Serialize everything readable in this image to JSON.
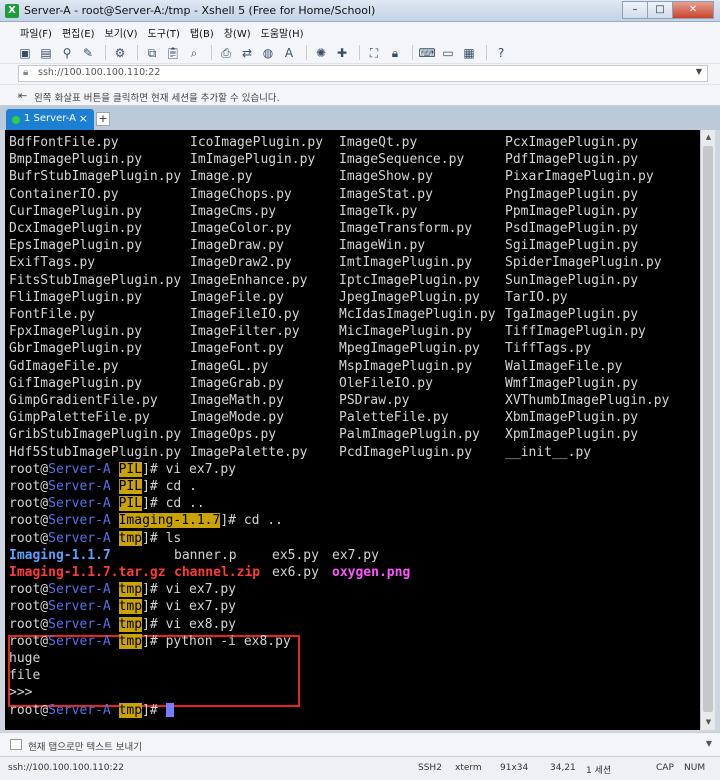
{
  "window": {
    "title": "Server-A - root@Server-A:/tmp - Xshell 5 (Free for Home/School)",
    "controls": [
      "–",
      "□",
      "✕"
    ]
  },
  "menu": [
    "파일(F)",
    "편집(E)",
    "보기(V)",
    "도구(T)",
    "탭(B)",
    "창(W)",
    "도움말(H)"
  ],
  "toolbar_icons": [
    "new-session-icon",
    "open-folder-icon",
    "connect-icon",
    "disconnect-icon",
    "properties-icon",
    "copy-icon",
    "paste-icon",
    "find-icon",
    "print-icon",
    "transfer-icon",
    "globe-icon",
    "font-icon",
    "xftp-icon",
    "xmanager-icon",
    "fullscreen-icon",
    "lock-icon",
    "keyboard-icon",
    "compose-icon",
    "tabs-icon",
    "help-icon"
  ],
  "address": {
    "value": "ssh://100.100.100.110:22"
  },
  "hint": {
    "text": "왼쪽 화살표 버튼을 클릭하면 현재 세션을 추가할 수 있습니다."
  },
  "tab": {
    "label": "1 Server-A",
    "close": "×",
    "add": "+"
  },
  "terminal": {
    "listing": [
      [
        "BdfFontFile.py",
        "IcoImagePlugin.py",
        "ImageQt.py",
        "PcxImagePlugin.py"
      ],
      [
        "BmpImagePlugin.py",
        "ImImagePlugin.py",
        "ImageSequence.py",
        "PdfImagePlugin.py"
      ],
      [
        "BufrStubImagePlugin.py",
        "Image.py",
        "ImageShow.py",
        "PixarImagePlugin.py"
      ],
      [
        "ContainerIO.py",
        "ImageChops.py",
        "ImageStat.py",
        "PngImagePlugin.py"
      ],
      [
        "CurImagePlugin.py",
        "ImageCms.py",
        "ImageTk.py",
        "PpmImagePlugin.py"
      ],
      [
        "DcxImagePlugin.py",
        "ImageColor.py",
        "ImageTransform.py",
        "PsdImagePlugin.py"
      ],
      [
        "EpsImagePlugin.py",
        "ImageDraw.py",
        "ImageWin.py",
        "SgiImagePlugin.py"
      ],
      [
        "ExifTags.py",
        "ImageDraw2.py",
        "ImtImagePlugin.py",
        "SpiderImagePlugin.py"
      ],
      [
        "FitsStubImagePlugin.py",
        "ImageEnhance.py",
        "IptcImagePlugin.py",
        "SunImagePlugin.py"
      ],
      [
        "FliImagePlugin.py",
        "ImageFile.py",
        "JpegImagePlugin.py",
        "TarIO.py"
      ],
      [
        "FontFile.py",
        "ImageFileIO.py",
        "McIdasImagePlugin.py",
        "TgaImagePlugin.py"
      ],
      [
        "FpxImagePlugin.py",
        "ImageFilter.py",
        "MicImagePlugin.py",
        "TiffImagePlugin.py"
      ],
      [
        "GbrImagePlugin.py",
        "ImageFont.py",
        "MpegImagePlugin.py",
        "TiffTags.py"
      ],
      [
        "GdImageFile.py",
        "ImageGL.py",
        "MspImagePlugin.py",
        "WalImageFile.py"
      ],
      [
        "GifImagePlugin.py",
        "ImageGrab.py",
        "OleFileIO.py",
        "WmfImagePlugin.py"
      ],
      [
        "GimpGradientFile.py",
        "ImageMath.py",
        "PSDraw.py",
        "XVThumbImagePlugin.py"
      ],
      [
        "GimpPaletteFile.py",
        "ImageMode.py",
        "PaletteFile.py",
        "XbmImagePlugin.py"
      ],
      [
        "GribStubImagePlugin.py",
        "ImageOps.py",
        "PalmImagePlugin.py",
        "XpmImagePlugin.py"
      ],
      [
        "Hdf5StubImagePlugin.py",
        "ImagePalette.py",
        "PcdImagePlugin.py",
        "__init__.py"
      ]
    ],
    "prompt": {
      "user": "root@",
      "host": "Server-A",
      "suffix": "]#"
    },
    "commands": [
      {
        "dir": "PIL",
        "cmd": "vi ex7.py"
      },
      {
        "dir": "PIL",
        "cmd": "cd ."
      },
      {
        "dir": "PIL",
        "cmd": "cd .."
      },
      {
        "dir": "Imaging-1.1.7",
        "cmd": "cd .."
      },
      {
        "dir": "tmp",
        "cmd": "ls"
      }
    ],
    "ls_output": [
      [
        "Imaging-1.1.7",
        "banner.p",
        "ex5.py",
        "ex7.py"
      ],
      [
        "Imaging-1.1.7.tar.gz",
        "channel.zip",
        "ex6.py",
        "oxygen.png"
      ]
    ],
    "commands2": [
      {
        "dir": "tmp",
        "cmd": "vi ex7.py"
      },
      {
        "dir": "tmp",
        "cmd": "vi ex7.py"
      },
      {
        "dir": "tmp",
        "cmd": "vi ex8.py"
      },
      {
        "dir": "tmp",
        "cmd": "python -i ex8.py"
      }
    ],
    "output": [
      "huge",
      "file",
      ">>>"
    ],
    "last_prompt_dir": "tmp"
  },
  "compose": {
    "text": "현재 탭으로만 텍스트 보내기"
  },
  "status": {
    "address": "ssh://100.100.100.110:22",
    "protocol": "SSH2",
    "term": "xterm",
    "size": "91x34",
    "cursor": "34,21",
    "sessions": "1 세션",
    "caps": "CAP",
    "num": "NUM"
  }
}
